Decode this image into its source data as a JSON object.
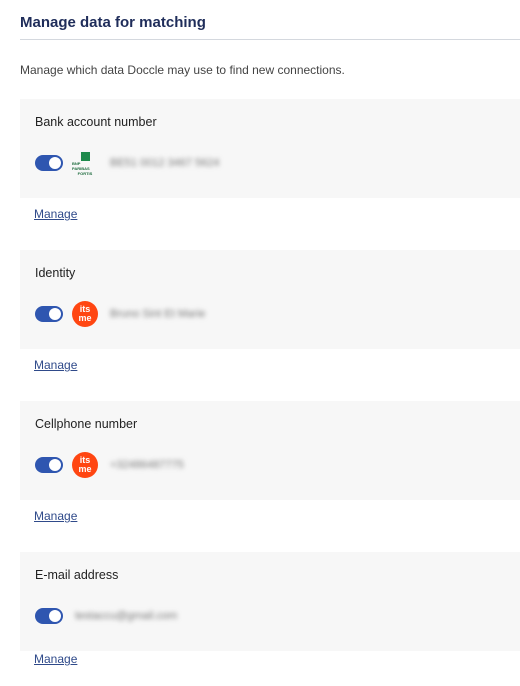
{
  "header": {
    "title": "Manage data for matching"
  },
  "description": "Manage which data Doccle may use to find new connections.",
  "sections": [
    {
      "title": "Bank account number",
      "enabled": true,
      "logo": "bnp-paribas-fortis-logo",
      "logo_text": [
        "BNP PARIBAS",
        "FORTIS"
      ],
      "value": "BE51 0012 3467 5624",
      "manage_label": "Manage"
    },
    {
      "title": "Identity",
      "enabled": true,
      "logo": "itsme-logo",
      "logo_text": [
        "its",
        "me"
      ],
      "value": "Bruno Sint Et Marie",
      "manage_label": "Manage"
    },
    {
      "title": "Cellphone number",
      "enabled": true,
      "logo": "itsme-logo",
      "logo_text": [
        "its",
        "me"
      ],
      "value": "+32486487775",
      "manage_label": "Manage"
    },
    {
      "title": "E-mail address",
      "enabled": true,
      "logo": "",
      "value": "testaccu@gmail.com",
      "manage_label": "Manage"
    }
  ],
  "colors": {
    "accent": "#2f56b0",
    "title": "#1f2d5a",
    "itsme": "#ff4612",
    "bnp": "#1e8a4c"
  }
}
